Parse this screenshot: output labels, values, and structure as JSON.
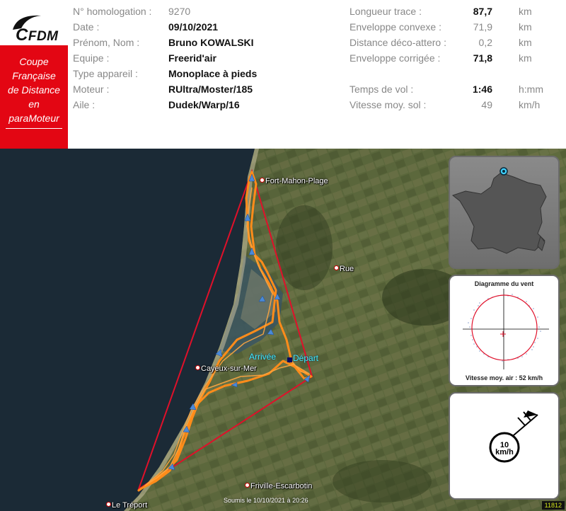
{
  "logo": {
    "text_c": "C",
    "text_rest": "FDM"
  },
  "promo": {
    "lines": [
      "Coupe",
      "Française",
      "de Distance",
      "en",
      "paraMoteur"
    ]
  },
  "info_left": [
    {
      "label": "N° homologation :",
      "value": "9270",
      "bold": false
    },
    {
      "label": "Date :",
      "value": "09/10/2021",
      "bold": true
    },
    {
      "label": "Prénom, Nom :",
      "value": "Bruno KOWALSKI",
      "bold": true
    },
    {
      "label": "Equipe :",
      "value": "Freerid'air",
      "bold": true
    },
    {
      "label": "Type appareil :",
      "value": "Monoplace à pieds",
      "bold": true
    },
    {
      "label": "Moteur :",
      "value": "RUltra/Moster/185",
      "bold": true
    },
    {
      "label": "Aile :",
      "value": "Dudek/Warp/16",
      "bold": true
    }
  ],
  "stats": [
    {
      "label": "Longueur trace :",
      "value": "87,7",
      "unit": "km",
      "bold": true
    },
    {
      "label": "Enveloppe convexe :",
      "value": "71,9",
      "unit": "km",
      "bold": false
    },
    {
      "label": "Distance déco-attero :",
      "value": "0,2",
      "unit": "km",
      "bold": false
    },
    {
      "label": "Enveloppe corrigée :",
      "value": "71,8",
      "unit": "km",
      "bold": true
    },
    {
      "label": "Temps de vol :",
      "value": "1:46",
      "unit": "h:mm",
      "bold": true
    },
    {
      "label": "Vitesse moy. sol :",
      "value": "49",
      "unit": "km/h",
      "bold": false
    }
  ],
  "map": {
    "towns": {
      "fort_mahon": "Fort-Mahon-Plage",
      "rue": "Rue",
      "cayeux": "Cayeux-sur-Mer",
      "le_treport": "Le Tréport",
      "friville": "Friville-Escarbotin"
    },
    "arrivee": "Arrivée",
    "depart": "Départ",
    "footer": "Soumis le 10/10/2021 à 20:26",
    "id": "11812"
  },
  "wind_panel": {
    "title": "Diagramme du vent",
    "caption": "Vitesse moy. air : 52 km/h"
  },
  "wind_arrow": {
    "speed_value": "10",
    "speed_unit": "km/h"
  },
  "colors": {
    "accent_red": "#e30613",
    "track": "#ff8c1a",
    "envelope": "#e0102a",
    "water": "#1a2a3a"
  }
}
